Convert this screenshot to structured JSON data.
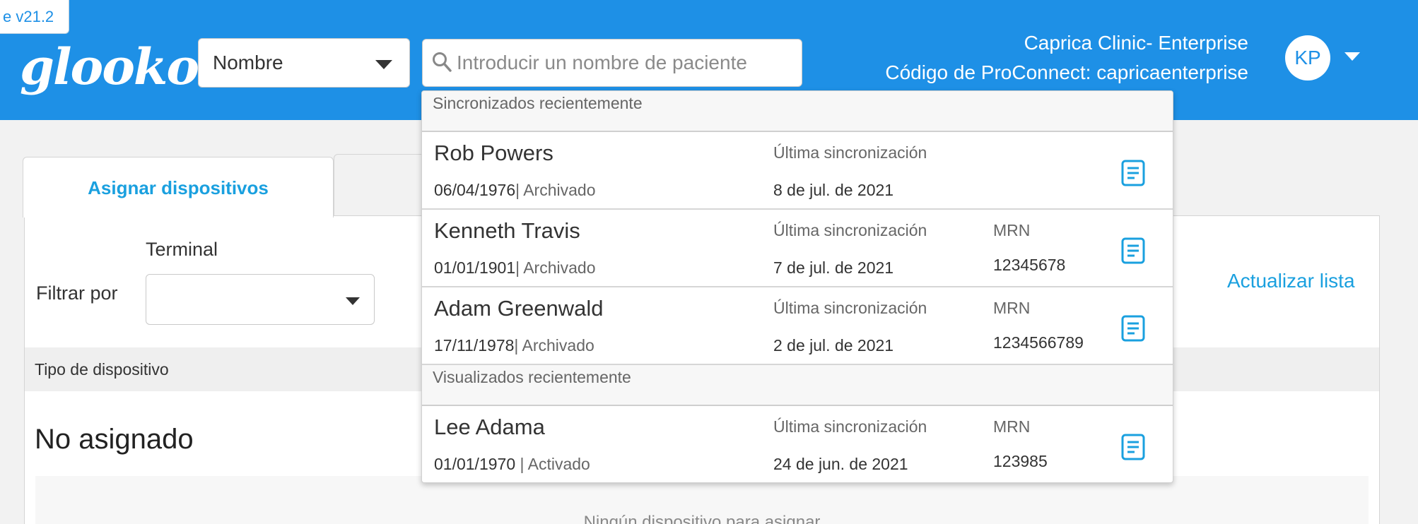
{
  "header": {
    "version": "e v21.2",
    "logo": "glooko",
    "search_type": "Nombre",
    "search_placeholder": "Introducir un nombre de paciente",
    "clinic_name": "Caprica Clinic- Enterprise",
    "proconnect_code": "Código de ProConnect: capricaenterprise",
    "user_initials": "KP"
  },
  "tabs": [
    {
      "label": "Asignar dispositivos"
    },
    {
      "label": ""
    }
  ],
  "filter": {
    "terminal_label": "Terminal",
    "filter_label": "Filtrar por",
    "terminal_value": ""
  },
  "actions": {
    "refresh": "Actualizar lista"
  },
  "table": {
    "column_header": "Tipo de dispositivo",
    "section_title": "No asignado",
    "empty_text": "Ningún dispositivo para asignar"
  },
  "dropdown": {
    "sections": [
      {
        "title": "Sincronizados recientemente",
        "patients": [
          {
            "name": "Rob Powers",
            "dob": "06/04/1976",
            "status": "| Archivado",
            "sync_label": "Última sincronización",
            "sync_date": "8 de jul. de 2021",
            "mrn_label": "",
            "mrn": ""
          },
          {
            "name": "Kenneth Travis",
            "dob": "01/01/1901",
            "status": "| Archivado",
            "sync_label": "Última sincronización",
            "sync_date": "7 de jul. de 2021",
            "mrn_label": "MRN",
            "mrn": "12345678"
          },
          {
            "name": "Adam Greenwald",
            "dob": "17/11/1978",
            "status": "| Archivado",
            "sync_label": "Última sincronización",
            "sync_date": "2 de jul. de 2021",
            "mrn_label": "MRN",
            "mrn": "1234566789"
          }
        ]
      },
      {
        "title": "Visualizados recientemente",
        "patients": [
          {
            "name": "Lee Adama",
            "dob": "01/01/1970",
            "status": " | Activado",
            "sync_label": "Última sincronización",
            "sync_date": "24 de jun. de 2021",
            "mrn_label": "MRN",
            "mrn": "123985"
          }
        ]
      }
    ]
  },
  "colors": {
    "brand_blue": "#1e90e6",
    "link_blue": "#1aa0df"
  }
}
